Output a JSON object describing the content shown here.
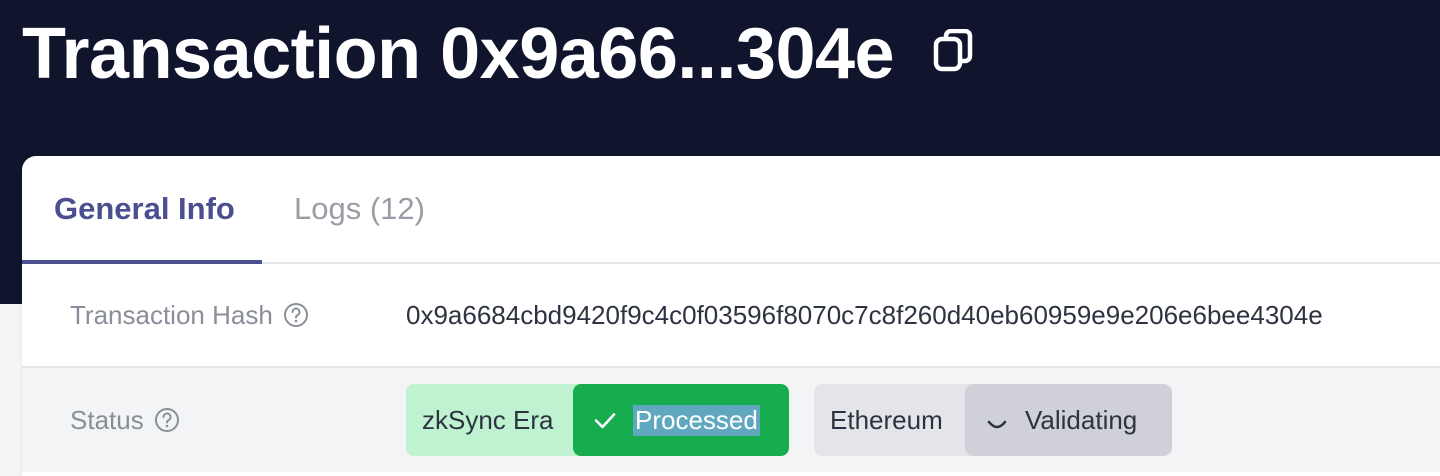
{
  "header": {
    "title": "Transaction 0x9a66...304e",
    "copy_icon": "copy-icon"
  },
  "tabs": [
    {
      "label": "General Info",
      "active": true
    },
    {
      "label": "Logs (12)",
      "active": false
    }
  ],
  "details": {
    "hash": {
      "label": "Transaction Hash",
      "value": "0x9a6684cbd9420f9c4c0f03596f8070c7c8f260d40eb60959e9e206e6bee4304e"
    },
    "status": {
      "label": "Status",
      "zksync": {
        "network": "zkSync Era",
        "state": "Processed",
        "icon": "check-icon"
      },
      "ethereum": {
        "network": "Ethereum",
        "state": "Validating",
        "icon": "spinner-icon"
      }
    }
  },
  "colors": {
    "hero_bg": "#11142d",
    "tab_active": "#4b4f8f",
    "processed_bg": "#17ad4f",
    "zksync_pill_bg": "#bff2d1",
    "validating_bg": "#d0d1d8",
    "ethereum_pill_bg": "#e4e5e9"
  }
}
